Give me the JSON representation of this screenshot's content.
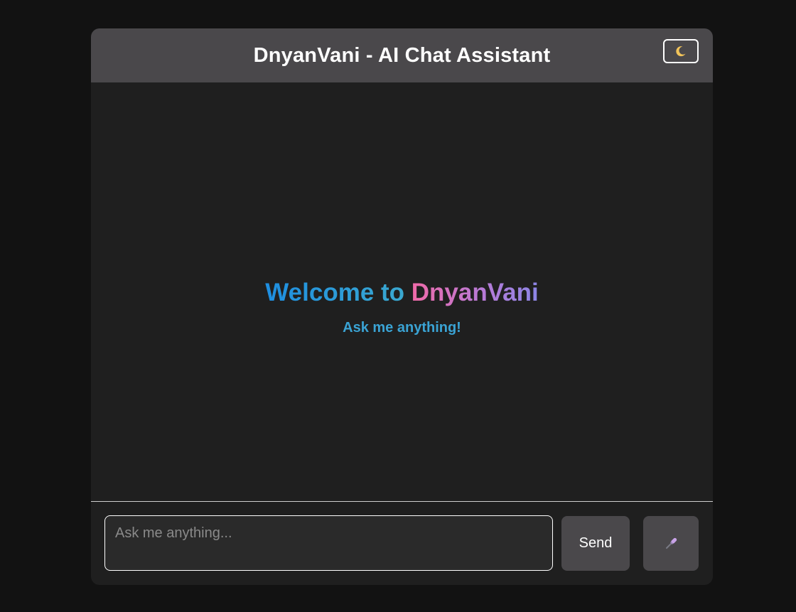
{
  "header": {
    "title": "DnyanVani - AI Chat Assistant",
    "theme_toggle_icon": "moon-icon"
  },
  "welcome": {
    "prefix": "Welcome to",
    "brand": "DnyanVani",
    "subtitle": "Ask me anything!"
  },
  "composer": {
    "input_value": "",
    "input_placeholder": "Ask me anything...",
    "send_label": "Send",
    "mic_icon": "microphone-icon"
  },
  "colors": {
    "page_background": "#121212",
    "panel_background": "#1f1f1f",
    "header_background": "#4a484b",
    "input_background": "#2a2a2a",
    "welcome_blue": "#1e8ee0",
    "welcome_pink": "#f06aa8",
    "welcome_purple": "#8c86e6",
    "subtitle_blue": "#3aa3d4"
  }
}
